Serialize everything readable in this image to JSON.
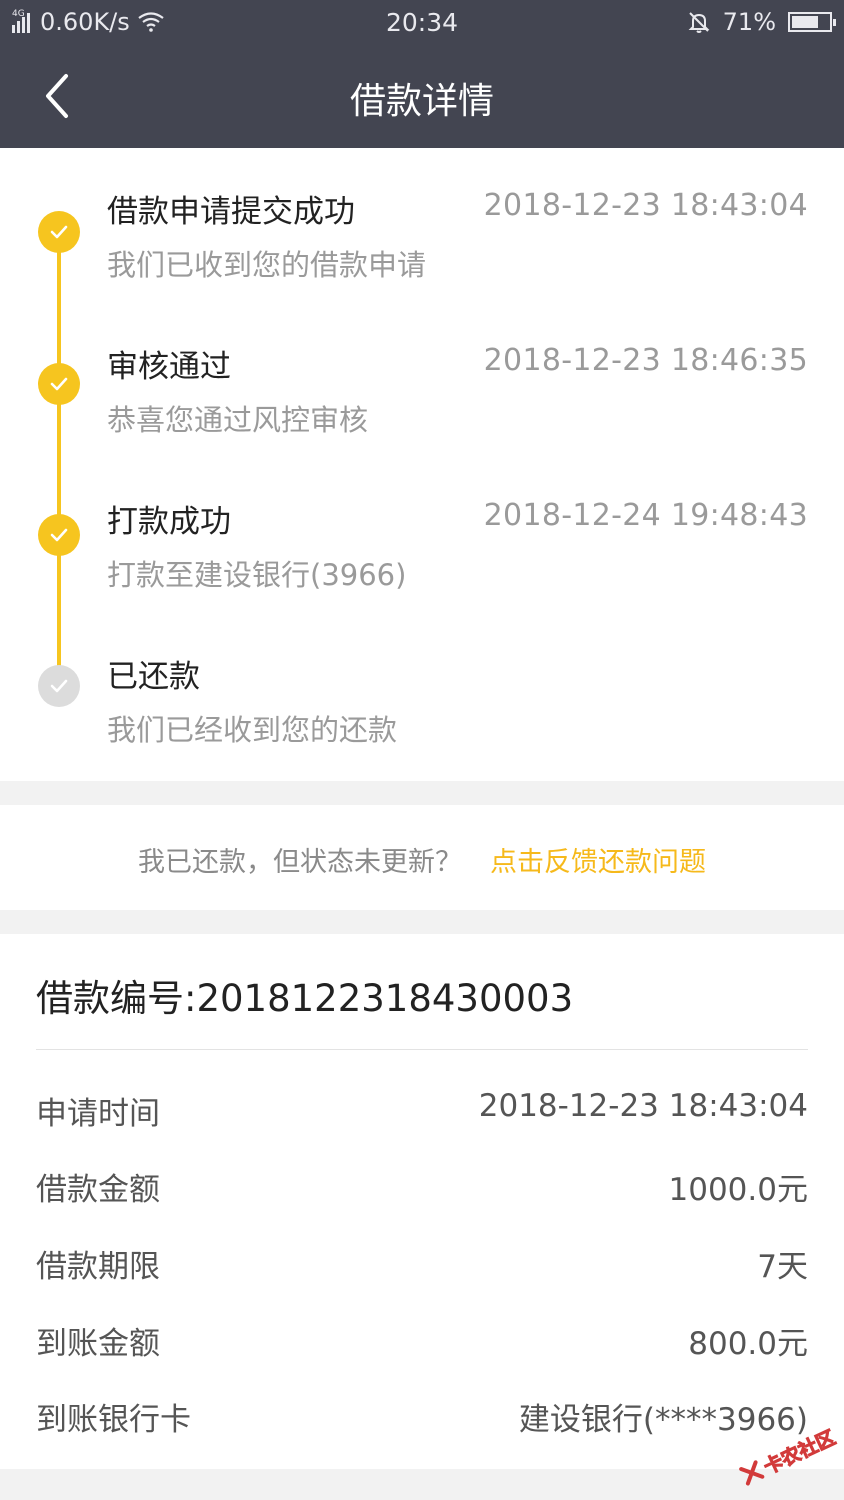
{
  "status_bar": {
    "network_type": "4G",
    "speed": "0.60K/s",
    "time": "20:34",
    "battery": "71%",
    "battery_level": 0.71,
    "icons": [
      "signal-icon",
      "wifi-icon",
      "silent-bell-icon",
      "battery-icon"
    ]
  },
  "header": {
    "title": "借款详情",
    "back_icon": "chevron-left-icon"
  },
  "timeline": {
    "accent_color": "#f6c51f",
    "pending_color": "#dcdcdc",
    "steps": [
      {
        "title": "借款申请提交成功",
        "time": "2018-12-23 18:43:04",
        "desc": "我们已收到您的借款申请",
        "done": true
      },
      {
        "title": "审核通过",
        "time": "2018-12-23 18:46:35",
        "desc": "恭喜您通过风控审核",
        "done": true
      },
      {
        "title": "打款成功",
        "time": "2018-12-24 19:48:43",
        "desc": "打款至建设银行(3966)",
        "done": true
      },
      {
        "title": "已还款",
        "time": "",
        "desc": "我们已经收到您的还款",
        "done": false
      }
    ]
  },
  "feedback": {
    "question": "我已还款，但状态未更新？",
    "link": "点击反馈还款问题",
    "link_color": "#f6b91b"
  },
  "details": {
    "loan_number": "借款编号:2018122318430003",
    "rows": [
      {
        "label": "申请时间",
        "value": "2018-12-23 18:43:04"
      },
      {
        "label": "借款金额",
        "value": "1000.0元"
      },
      {
        "label": "借款期限",
        "value": "7天"
      },
      {
        "label": "到账金额",
        "value": "800.0元"
      },
      {
        "label": "到账银行卡",
        "value": "建设银行(****3966)"
      }
    ]
  },
  "watermark": {
    "text": "卡农社区",
    "logo_icon": "kanong-logo-icon"
  }
}
